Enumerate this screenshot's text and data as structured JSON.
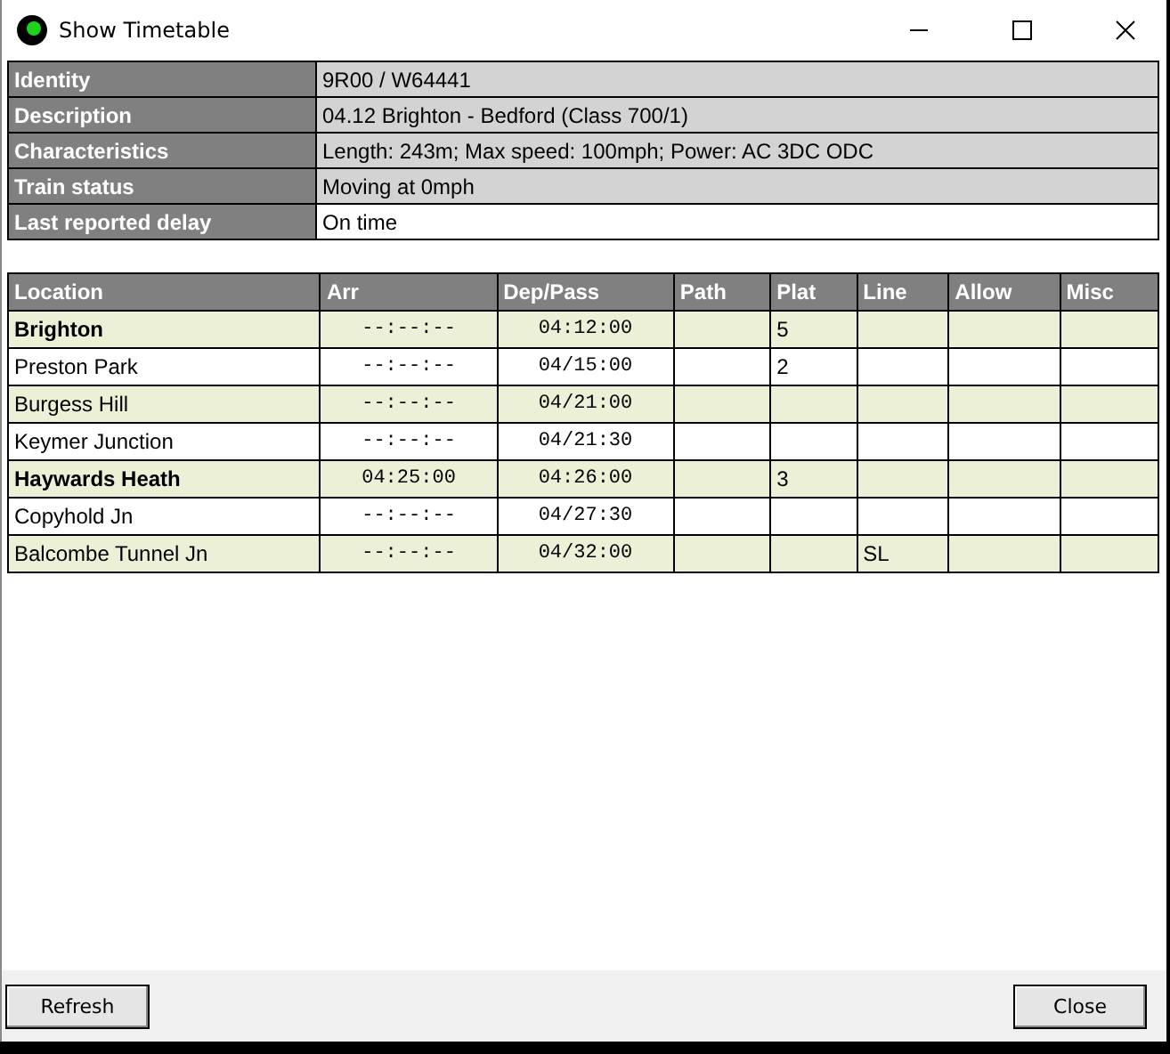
{
  "window": {
    "title": "Show Timetable"
  },
  "info": [
    {
      "label": "Identity",
      "value": "9R00 / W64441",
      "shaded": true
    },
    {
      "label": "Description",
      "value": "04.12 Brighton - Bedford (Class 700/1)",
      "shaded": true
    },
    {
      "label": "Characteristics",
      "value": "Length: 243m; Max speed: 100mph; Power: AC 3DC ODC",
      "shaded": true
    },
    {
      "label": "Train status",
      "value": "Moving at 0mph",
      "shaded": true
    },
    {
      "label": "Last reported delay",
      "value": "On time",
      "shaded": false
    }
  ],
  "table": {
    "columns": [
      "Location",
      "Arr",
      "Dep/Pass",
      "Path",
      "Plat",
      "Line",
      "Allow",
      "Misc"
    ],
    "rows": [
      {
        "kind": "stop",
        "cells": [
          "Brighton",
          "--:--:--",
          "04:12:00",
          "",
          "5",
          "",
          "",
          ""
        ]
      },
      {
        "kind": "pass",
        "cells": [
          "Preston Park",
          "--:--:--",
          "04/15:00",
          "",
          "2",
          "",
          "",
          ""
        ]
      },
      {
        "kind": "pass",
        "cells": [
          "Burgess Hill",
          "--:--:--",
          "04/21:00",
          "",
          "",
          "",
          "",
          ""
        ]
      },
      {
        "kind": "pass",
        "cells": [
          "Keymer Junction",
          "--:--:--",
          "04/21:30",
          "",
          "",
          "",
          "",
          ""
        ]
      },
      {
        "kind": "stop",
        "cells": [
          "Haywards Heath",
          "04:25:00",
          "04:26:00",
          "",
          "3",
          "",
          "",
          ""
        ]
      },
      {
        "kind": "pass",
        "cells": [
          "Copyhold Jn",
          "--:--:--",
          "04/27:30",
          "",
          "",
          "",
          "",
          ""
        ]
      },
      {
        "kind": "pass",
        "cells": [
          "Balcombe Tunnel Jn",
          "--:--:--",
          "04/32:00",
          "",
          "",
          "SL",
          "",
          ""
        ]
      }
    ]
  },
  "buttons": [
    "Refresh",
    "Close"
  ]
}
